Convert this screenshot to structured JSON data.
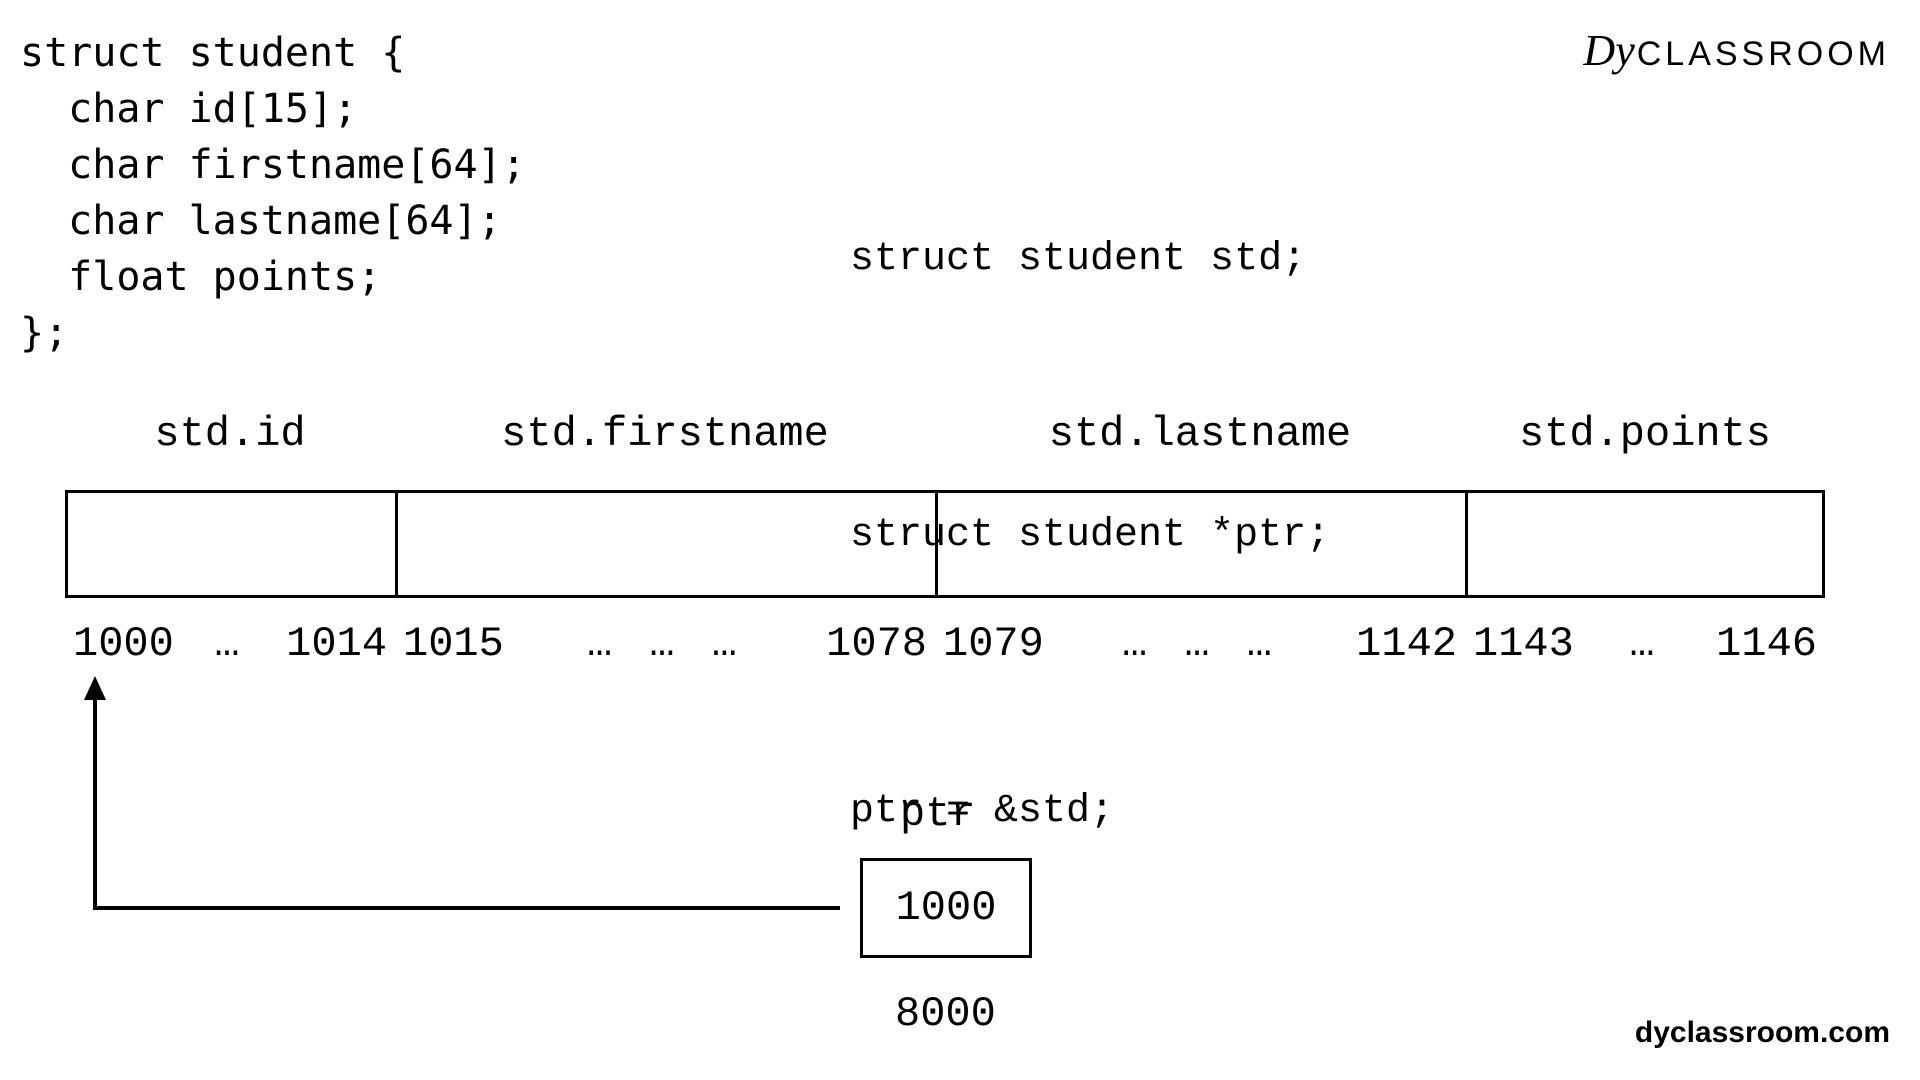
{
  "logo": {
    "script": "Dy",
    "text": "CLASSROOM"
  },
  "code_left": "struct student {\n  char id[15];\n  char firstname[64];\n  char lastname[64];\n  float points;\n};",
  "code_right_lines": {
    "l1": "struct student std;",
    "l2": "struct student *ptr;",
    "l3": "ptr = &std;"
  },
  "fields": {
    "id": "std.id",
    "firstname": "std.firstname",
    "lastname": "std.lastname",
    "points": "std.points"
  },
  "addresses": {
    "id_start": "1000",
    "id_end": "1014",
    "fn_start": "1015",
    "fn_end": "1078",
    "ln_start": "1079",
    "ln_end": "1142",
    "pt_start": "1143",
    "pt_end": "1146",
    "ellipsis1": "…",
    "ellipsis3": "…   …   …",
    "ellipsis3b": "…   …   …",
    "ellipsis1b": "…"
  },
  "pointer": {
    "label": "ptr",
    "value": "1000",
    "address": "8000"
  },
  "site": "dyclassroom.com",
  "chart_data": {
    "type": "diagram",
    "description": "C struct pointer memory layout illustration",
    "struct_definition": {
      "name": "student",
      "members": [
        {
          "name": "id",
          "type": "char[15]",
          "bytes": 15
        },
        {
          "name": "firstname",
          "type": "char[64]",
          "bytes": 64
        },
        {
          "name": "lastname",
          "type": "char[64]",
          "bytes": 64
        },
        {
          "name": "points",
          "type": "float",
          "bytes": 4
        }
      ]
    },
    "memory_layout": [
      {
        "field": "std.id",
        "start": 1000,
        "end": 1014
      },
      {
        "field": "std.firstname",
        "start": 1015,
        "end": 1078
      },
      {
        "field": "std.lastname",
        "start": 1079,
        "end": 1142
      },
      {
        "field": "std.points",
        "start": 1143,
        "end": 1146
      }
    ],
    "pointer_variable": {
      "name": "ptr",
      "stored_value": 1000,
      "own_address": 8000,
      "points_to": "std (address 1000)"
    }
  }
}
